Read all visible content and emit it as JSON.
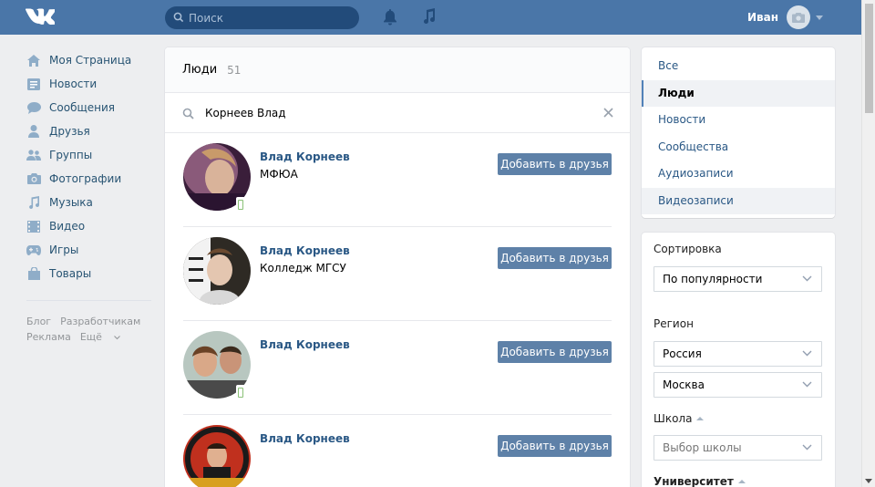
{
  "header": {
    "search_placeholder": "Поиск",
    "user_name": "Иван"
  },
  "leftnav": {
    "items": [
      {
        "label": "Моя Страница",
        "icon": "home-icon"
      },
      {
        "label": "Новости",
        "icon": "news-icon"
      },
      {
        "label": "Сообщения",
        "icon": "messages-icon"
      },
      {
        "label": "Друзья",
        "icon": "friends-icon"
      },
      {
        "label": "Группы",
        "icon": "groups-icon"
      },
      {
        "label": "Фотографии",
        "icon": "camera-icon"
      },
      {
        "label": "Музыка",
        "icon": "music-icon"
      },
      {
        "label": "Видео",
        "icon": "video-icon"
      },
      {
        "label": "Игры",
        "icon": "gamepad-icon"
      },
      {
        "label": "Товары",
        "icon": "bag-icon"
      }
    ],
    "footer": {
      "blog": "Блог",
      "developers": "Разработчикам",
      "ads": "Реклама",
      "more": "Ещё"
    }
  },
  "main": {
    "title": "Люди",
    "count": "51",
    "query": "Корнеев Влад",
    "people": [
      {
        "name": "Влад Корнеев",
        "info": "МФЮА",
        "mobile": true,
        "button": "Добавить в друзья"
      },
      {
        "name": "Влад Корнеев",
        "info": "Колледж МГСУ",
        "mobile": false,
        "button": "Добавить в друзья"
      },
      {
        "name": "Влад Корнеев",
        "info": "",
        "mobile": true,
        "button": "Добавить в друзья"
      },
      {
        "name": "Влад Корнеев",
        "info": "",
        "mobile": false,
        "button": "Добавить в друзья"
      }
    ]
  },
  "rightnav": {
    "items": [
      "Все",
      "Люди",
      "Новости",
      "Сообщества",
      "Аудиозаписи",
      "Видеозаписи"
    ],
    "active": "Люди"
  },
  "filters": {
    "sort_label": "Сортировка",
    "sort_value": "По популярности",
    "region_label": "Регион",
    "country_value": "Россия",
    "city_value": "Москва",
    "school_label": "Школа",
    "school_placeholder": "Выбор школы",
    "university_label": "Университет"
  },
  "colors": {
    "header": "#4a76a8",
    "link": "#2a5885",
    "button": "#5e81a8",
    "online_mobile": "#8ac176"
  }
}
